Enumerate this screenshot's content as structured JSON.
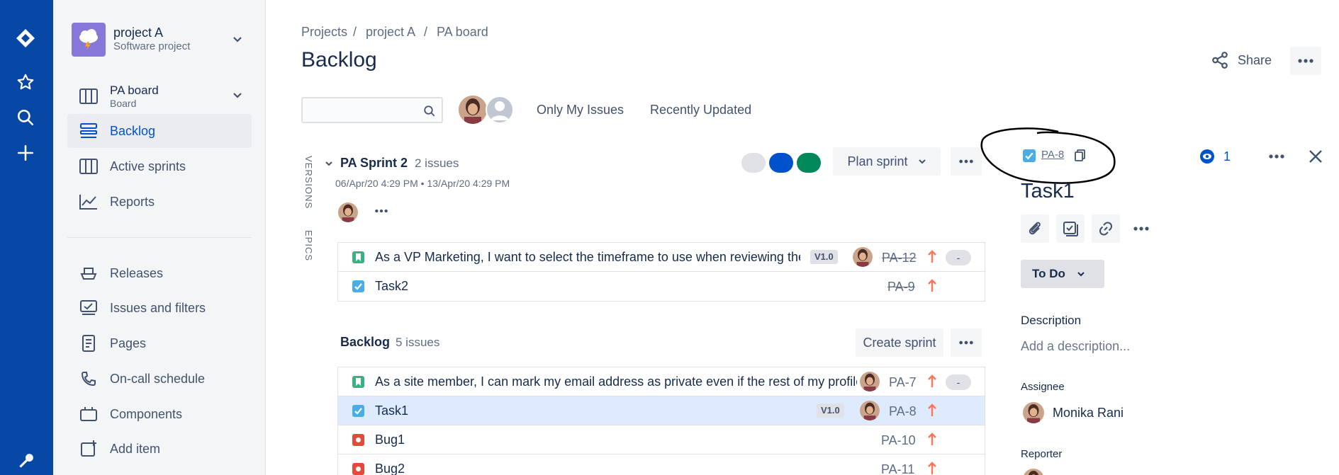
{
  "project": {
    "name": "project A",
    "type": "Software project"
  },
  "sidebar": {
    "board": {
      "name": "PA board",
      "sub": "Board"
    },
    "items": [
      {
        "label": "Backlog",
        "icon": "backlog-icon",
        "active": true
      },
      {
        "label": "Active sprints",
        "icon": "board-icon"
      },
      {
        "label": "Reports",
        "icon": "chart-icon"
      },
      {
        "label": "Releases",
        "icon": "ship-icon"
      },
      {
        "label": "Issues and filters",
        "icon": "filter-icon"
      },
      {
        "label": "Pages",
        "icon": "page-icon"
      },
      {
        "label": "On-call schedule",
        "icon": "phone-icon"
      },
      {
        "label": "Components",
        "icon": "component-icon"
      },
      {
        "label": "Add item",
        "icon": "add-item-icon"
      }
    ]
  },
  "breadcrumb": {
    "projects": "Projects",
    "project": "project A",
    "board": "PA board",
    "sep": "/"
  },
  "header": {
    "title": "Backlog",
    "share_label": "Share"
  },
  "filters": {
    "only_my_issues": "Only My Issues",
    "recently_updated": "Recently Updated"
  },
  "side_tabs": {
    "versions": "VERSIONS",
    "epics": "EPICS"
  },
  "sprint": {
    "name": "PA Sprint 2",
    "count": "2 issues",
    "dates": "06/Apr/20 4:29 PM • 13/Apr/20 4:29 PM",
    "plan_label": "Plan sprint",
    "dot_colors": [
      "#DFE1E6",
      "#0052CC",
      "#00875A"
    ],
    "issues": [
      {
        "type": "story",
        "title": "As a VP Marketing, I want to select the timeframe to use when reviewing the p",
        "version": "V1.0",
        "key": "PA-12",
        "done": true,
        "estimate": "-"
      },
      {
        "type": "task",
        "title": "Task2",
        "key": "PA-9",
        "done": true
      }
    ]
  },
  "backlog": {
    "title": "Backlog",
    "count": "5 issues",
    "create_label": "Create sprint",
    "issues": [
      {
        "type": "story",
        "title": "As a site member, I can mark my email address as private even if the rest of my profile is",
        "key": "PA-7",
        "estimate": "-"
      },
      {
        "type": "task",
        "title": "Task1",
        "version": "V1.0",
        "key": "PA-8",
        "selected": true
      },
      {
        "type": "bug",
        "title": "Bug1",
        "key": "PA-10"
      },
      {
        "type": "bug",
        "title": "Bug2",
        "key": "PA-11"
      }
    ]
  },
  "detail": {
    "key": "PA-8",
    "title": "Task1",
    "watchers": "1",
    "status": "To Do",
    "description_label": "Description",
    "description_placeholder": "Add a description...",
    "assignee_label": "Assignee",
    "assignee": "Monika Rani",
    "reporter_label": "Reporter"
  },
  "colors": {
    "nav": "#0747A6",
    "accent": "#0052CC",
    "story": "#36B37E",
    "task": "#4BADE8",
    "bug": "#E5493A",
    "priority": "#FF7452"
  }
}
